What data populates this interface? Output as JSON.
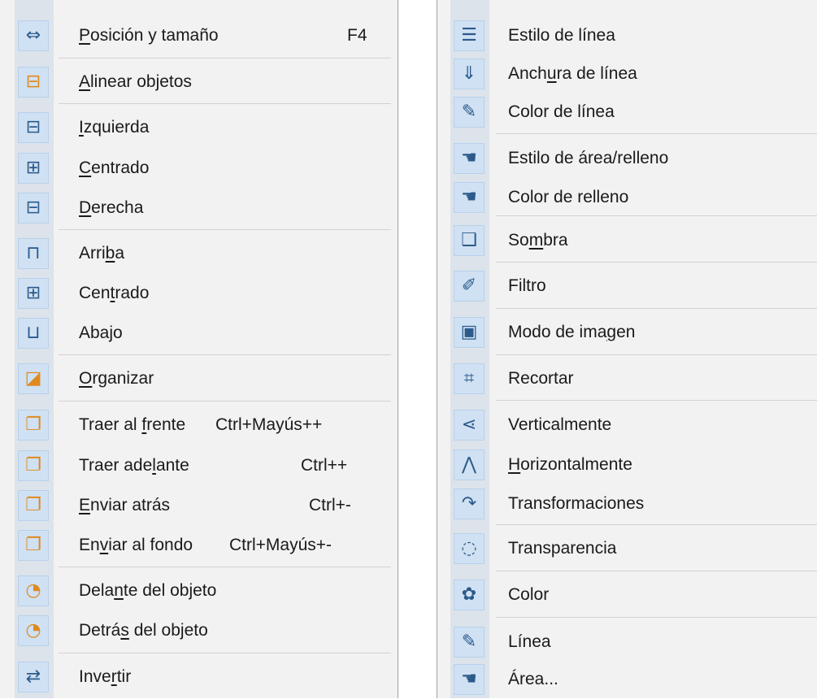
{
  "left_menu": {
    "items": [
      {
        "pre": "",
        "u": "P",
        "post": "osición y tamaño",
        "shortcut": "F4",
        "icon": "position-size-icon",
        "glyph": "⇔"
      },
      {
        "pre": "",
        "u": "A",
        "post": "linear objetos",
        "shortcut": "",
        "icon": "align-objects-icon",
        "glyph": "⊟"
      },
      {
        "pre": "",
        "u": "I",
        "post": "zquierda",
        "shortcut": "",
        "icon": "align-left-icon",
        "glyph": "⊟"
      },
      {
        "pre": "",
        "u": "C",
        "post": "entrado",
        "shortcut": "",
        "icon": "align-center-icon",
        "glyph": "⊞"
      },
      {
        "pre": "",
        "u": "D",
        "post": "erecha",
        "shortcut": "",
        "icon": "align-right-icon",
        "glyph": "⊟"
      },
      {
        "pre": "Arri",
        "u": "b",
        "post": "a",
        "shortcut": "",
        "icon": "align-top-icon",
        "glyph": "⊓"
      },
      {
        "pre": "Cen",
        "u": "t",
        "post": "rado",
        "shortcut": "",
        "icon": "align-middle-icon",
        "glyph": "⊞"
      },
      {
        "pre": "Aba",
        "u": "j",
        "post": "o",
        "shortcut": "",
        "icon": "align-bottom-icon",
        "glyph": "⊔"
      },
      {
        "pre": "",
        "u": "O",
        "post": "rganizar",
        "shortcut": "",
        "icon": "arrange-icon",
        "glyph": "◪"
      },
      {
        "pre": "Traer al ",
        "u": "f",
        "post": "rente",
        "shortcut": "Ctrl+Mayús++",
        "icon": "bring-to-front-icon",
        "glyph": "❐"
      },
      {
        "pre": "Traer ade",
        "u": "l",
        "post": "ante",
        "shortcut": "Ctrl++",
        "icon": "bring-forward-icon",
        "glyph": "❐"
      },
      {
        "pre": "",
        "u": "E",
        "post": "nviar atrás",
        "shortcut": "Ctrl+-",
        "icon": "send-backward-icon",
        "glyph": "❐"
      },
      {
        "pre": "En",
        "u": "v",
        "post": "iar al fondo",
        "shortcut": "Ctrl+Mayús+-",
        "icon": "send-to-back-icon",
        "glyph": "❐"
      },
      {
        "pre": "Dela",
        "u": "n",
        "post": "te del objeto",
        "shortcut": "",
        "icon": "in-front-of-object-icon",
        "glyph": "◔"
      },
      {
        "pre": "Detrá",
        "u": "s",
        "post": " del objeto",
        "shortcut": "",
        "icon": "behind-object-icon",
        "glyph": "◔"
      },
      {
        "pre": "Inve",
        "u": "r",
        "post": "tir",
        "shortcut": "",
        "icon": "reverse-icon",
        "glyph": "⇄"
      }
    ]
  },
  "right_menu": {
    "items": [
      {
        "pre": "Estilo de línea",
        "u": "",
        "post": "",
        "icon": "line-style-icon",
        "glyph": "☰"
      },
      {
        "pre": "Anch",
        "u": "u",
        "post": "ra de línea",
        "icon": "line-width-icon",
        "glyph": "⇓"
      },
      {
        "pre": "Color de línea",
        "u": "",
        "post": "",
        "icon": "line-color-icon",
        "glyph": "✎"
      },
      {
        "pre": "Estilo de área/relleno",
        "u": "",
        "post": "",
        "icon": "area-style-icon",
        "glyph": "☚"
      },
      {
        "pre": "Color de relleno",
        "u": "",
        "post": "",
        "icon": "fill-color-icon",
        "glyph": "☚"
      },
      {
        "pre": "So",
        "u": "m",
        "post": "bra",
        "icon": "shadow-icon",
        "glyph": "❑"
      },
      {
        "pre": "Filtro",
        "u": "",
        "post": "",
        "icon": "filter-icon",
        "glyph": "✐"
      },
      {
        "pre": "Modo de ima",
        "u": "g",
        "post": "en",
        "icon": "image-mode-icon",
        "glyph": "▣"
      },
      {
        "pre": "Recortar",
        "u": "",
        "post": "",
        "icon": "crop-icon",
        "glyph": "⌗"
      },
      {
        "pre": "Verticalmente",
        "u": "",
        "post": "",
        "icon": "flip-vertical-icon",
        "glyph": "⋖"
      },
      {
        "pre": "",
        "u": "H",
        "post": "orizontalmente",
        "icon": "flip-horizontal-icon",
        "glyph": "⋀"
      },
      {
        "pre": "Transformaciones",
        "u": "",
        "post": "",
        "icon": "transformations-icon",
        "glyph": "↷"
      },
      {
        "pre": "Transparencia",
        "u": "",
        "post": "",
        "icon": "transparency-icon",
        "glyph": "◌"
      },
      {
        "pre": "Color",
        "u": "",
        "post": "",
        "icon": "color-icon",
        "glyph": "✿"
      },
      {
        "pre": "Línea",
        "u": "",
        "post": "",
        "icon": "line-icon",
        "glyph": "✎"
      },
      {
        "pre": "Área...",
        "u": "",
        "post": "",
        "icon": "area-icon",
        "glyph": "☚"
      }
    ]
  }
}
